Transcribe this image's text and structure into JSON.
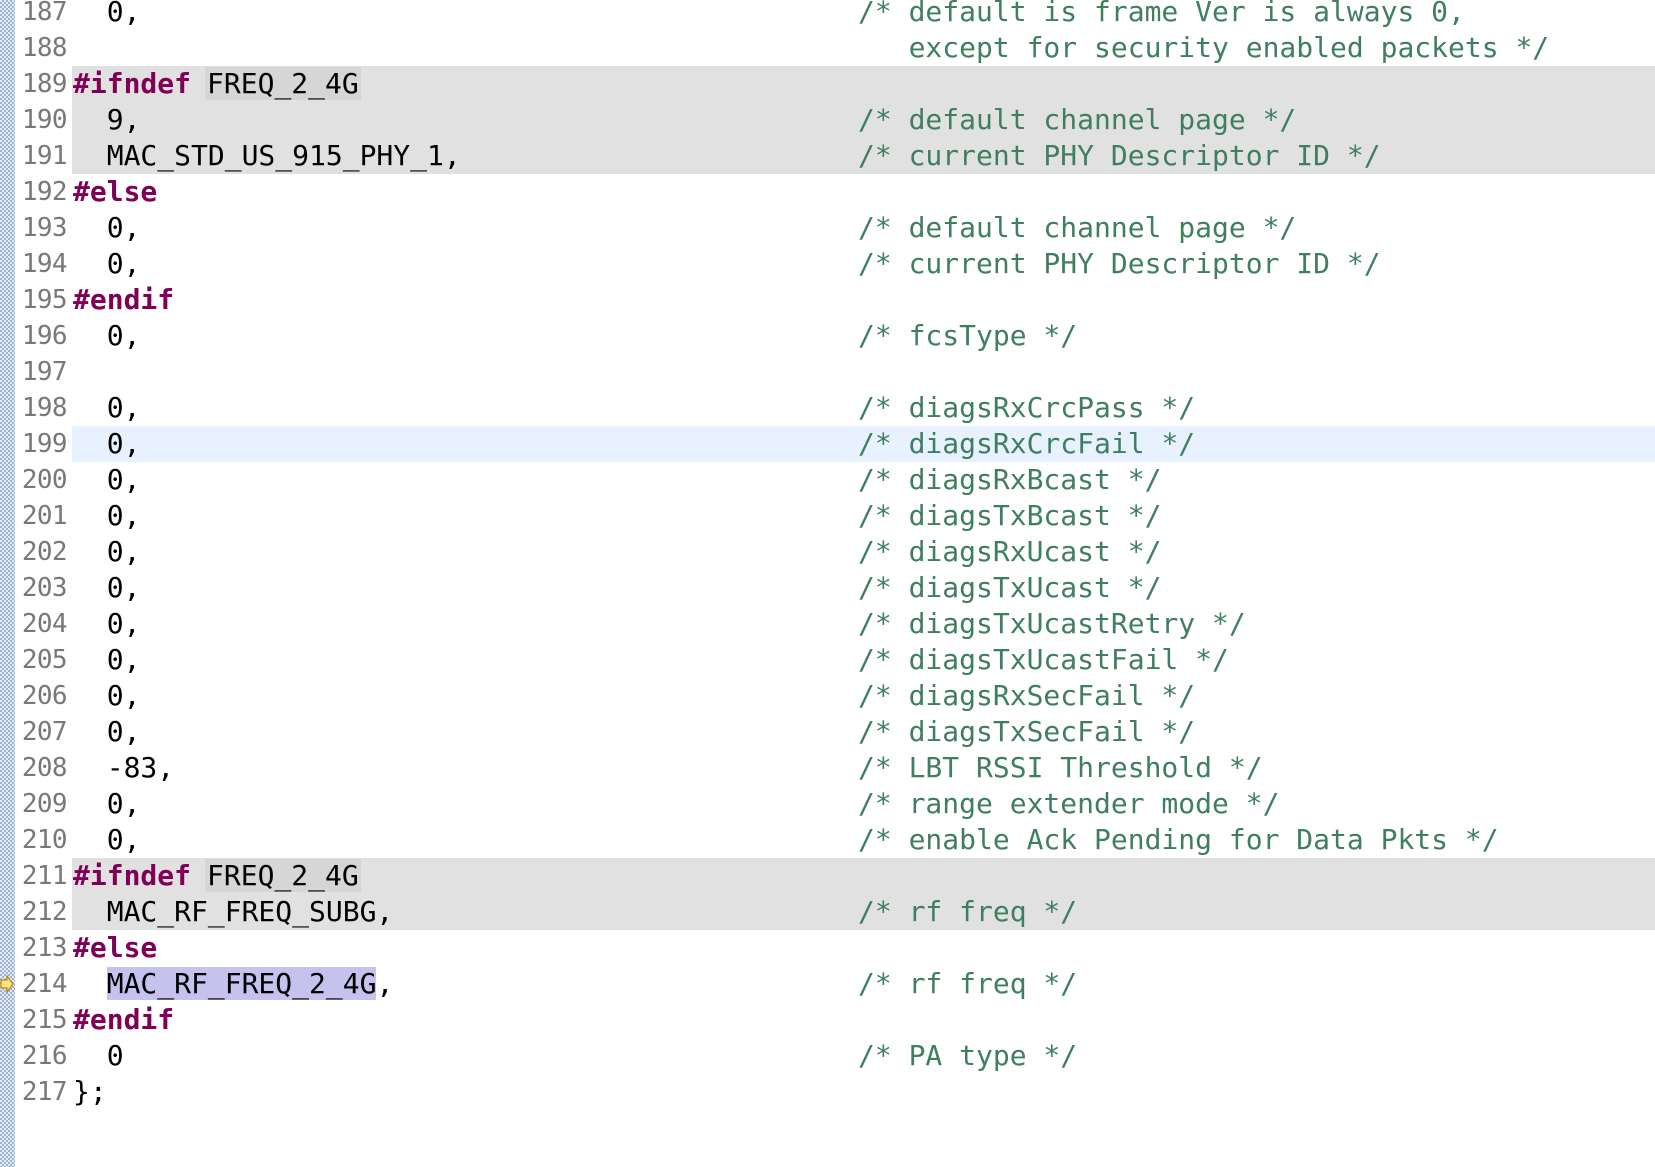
{
  "editor": {
    "selection_text": "MAC_RF_FREQ_2_4G",
    "lines": [
      {
        "num": "187",
        "code": "  0,",
        "comment": "/* default is frame Ver is always 0,",
        "kind": "normal"
      },
      {
        "num": "188",
        "code": "",
        "comment": "   except for security enabled packets */",
        "kind": "normal"
      },
      {
        "num": "189",
        "directive": "#ifndef",
        "macro": "FREQ_2_4G",
        "kind": "inactive"
      },
      {
        "num": "190",
        "code": "  9,",
        "comment": "/* default channel page */",
        "kind": "inactive"
      },
      {
        "num": "191",
        "code": "  MAC_STD_US_915_PHY_1,",
        "comment": "/* current PHY Descriptor ID */",
        "kind": "inactive"
      },
      {
        "num": "192",
        "directive": "#else",
        "kind": "normal"
      },
      {
        "num": "193",
        "code": "  0,",
        "comment": "/* default channel page */",
        "kind": "normal"
      },
      {
        "num": "194",
        "code": "  0,",
        "comment": "/* current PHY Descriptor ID */",
        "kind": "normal"
      },
      {
        "num": "195",
        "directive": "#endif",
        "kind": "normal"
      },
      {
        "num": "196",
        "code": "  0,",
        "comment": "/* fcsType */",
        "kind": "normal"
      },
      {
        "num": "197",
        "code": "",
        "comment": "",
        "kind": "normal"
      },
      {
        "num": "198",
        "code": "  0,",
        "comment": "/* diagsRxCrcPass */",
        "kind": "normal"
      },
      {
        "num": "199",
        "code": "  0,",
        "comment": "/* diagsRxCrcFail */",
        "kind": "current"
      },
      {
        "num": "200",
        "code": "  0,",
        "comment": "/* diagsRxBcast */",
        "kind": "normal"
      },
      {
        "num": "201",
        "code": "  0,",
        "comment": "/* diagsTxBcast */",
        "kind": "normal"
      },
      {
        "num": "202",
        "code": "  0,",
        "comment": "/* diagsRxUcast */",
        "kind": "normal"
      },
      {
        "num": "203",
        "code": "  0,",
        "comment": "/* diagsTxUcast */",
        "kind": "normal"
      },
      {
        "num": "204",
        "code": "  0,",
        "comment": "/* diagsTxUcastRetry */",
        "kind": "normal"
      },
      {
        "num": "205",
        "code": "  0,",
        "comment": "/* diagsTxUcastFail */",
        "kind": "normal"
      },
      {
        "num": "206",
        "code": "  0,",
        "comment": "/* diagsRxSecFail */",
        "kind": "normal"
      },
      {
        "num": "207",
        "code": "  0,",
        "comment": "/* diagsTxSecFail */",
        "kind": "normal"
      },
      {
        "num": "208",
        "code": "  -83,",
        "comment": "/* LBT RSSI Threshold */",
        "kind": "normal"
      },
      {
        "num": "209",
        "code": "  0,",
        "comment": "/* range extender mode */",
        "kind": "normal"
      },
      {
        "num": "210",
        "code": "  0,",
        "comment": "/* enable Ack Pending for Data Pkts */",
        "kind": "normal"
      },
      {
        "num": "211",
        "directive": "#ifndef",
        "macro": "FREQ_2_4G",
        "kind": "inactive"
      },
      {
        "num": "212",
        "code": "  MAC_RF_FREQ_SUBG,",
        "comment": "/* rf freq */",
        "kind": "inactive"
      },
      {
        "num": "213",
        "directive": "#else",
        "kind": "normal"
      },
      {
        "num": "214",
        "code": "  ",
        "selected": "MAC_RF_FREQ_2_4G",
        "after": ",",
        "comment": "/* rf freq */",
        "kind": "normal",
        "exec": true
      },
      {
        "num": "215",
        "directive": "#endif",
        "kind": "normal"
      },
      {
        "num": "216",
        "code": "  0",
        "comment": "/* PA type */",
        "kind": "normal"
      },
      {
        "num": "217",
        "code": "};",
        "comment": "",
        "kind": "normal"
      }
    ]
  },
  "colors": {
    "keyword": "#7f0055",
    "comment": "#3f7f5f",
    "line_number": "#787878",
    "inactive_background": "#e1e1e1",
    "current_line": "#e8f2fe",
    "selection": "#c6c2ee"
  },
  "icons": {
    "execution_marker": "instruction-pointer-arrow-icon"
  }
}
